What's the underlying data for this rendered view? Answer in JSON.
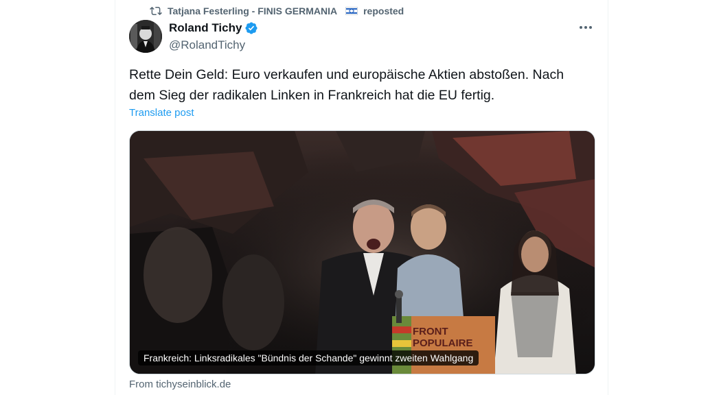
{
  "repost": {
    "user": "Tatjana Festerling - FINIS GERMANIA",
    "label": "reposted"
  },
  "author": {
    "name": "Roland Tichy",
    "handle": "@RolandTichy",
    "verified": true
  },
  "tweet": {
    "text_line1": "Rette Dein Geld: Euro verkaufen und europäische Aktien abstoßen. Nach",
    "text_line2": "dem Sieg der radikalen Linken in Frankreich hat die EU fertig.",
    "translate_label": "Translate post"
  },
  "card": {
    "caption": "Frankreich: Linksradikales \"Bündnis der Schande\" gewinnt zweiten Wahlgang",
    "source": "From tichyseinblick.de",
    "podium_text_top": "FRONT",
    "podium_text_bottom": "POPULAIRE"
  },
  "colors": {
    "link": "#1d9bf0",
    "secondary_text": "#536471",
    "primary_text": "#0f1419",
    "verified": "#1d9bf0"
  },
  "icons": {
    "repost": "repost-icon",
    "verified": "verified-badge-icon",
    "more": "more-icon",
    "flag": "israel-flag-icon"
  }
}
